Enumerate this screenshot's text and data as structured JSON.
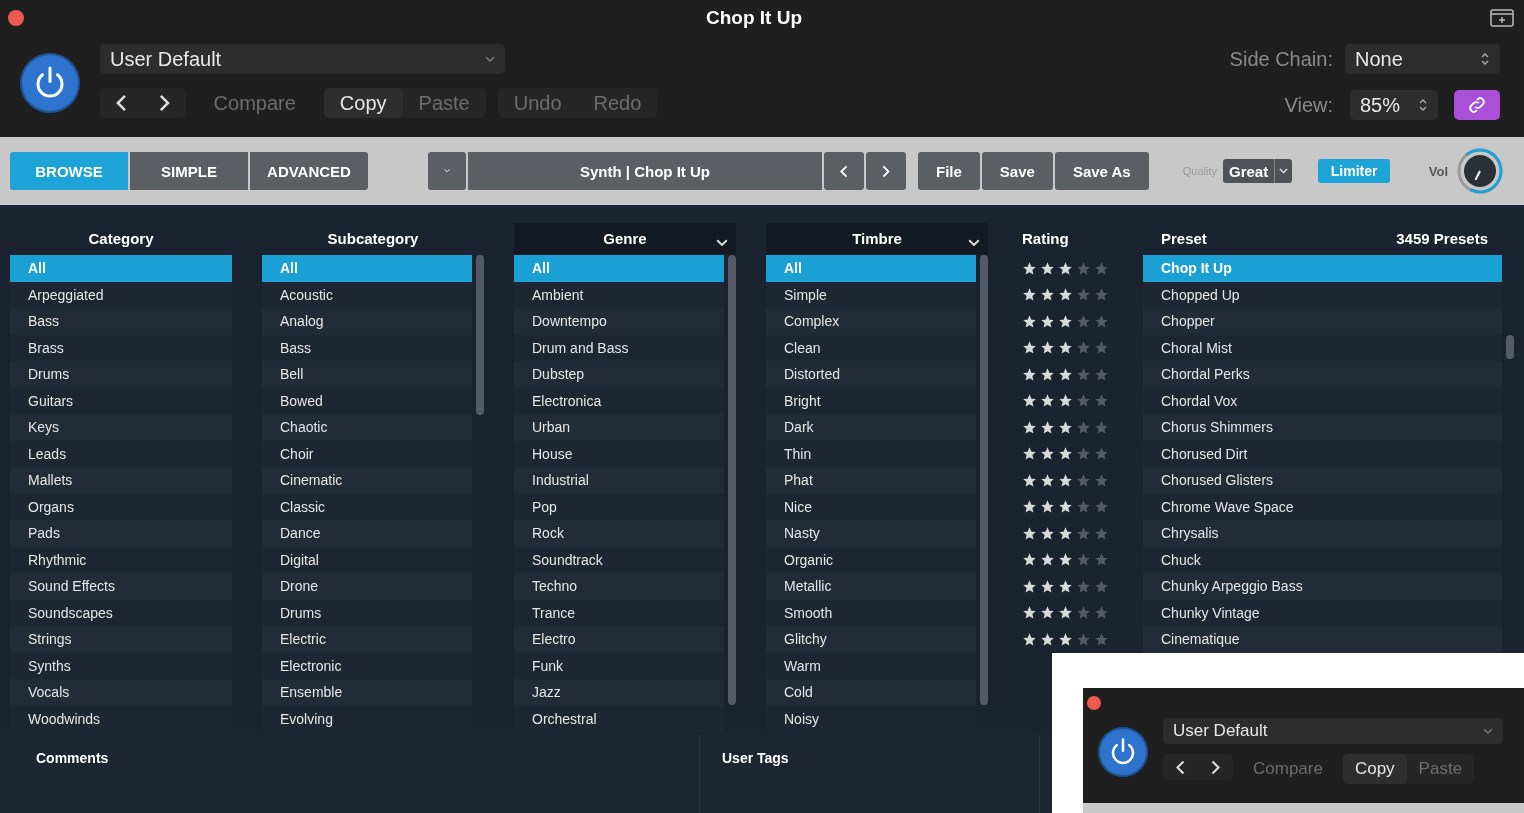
{
  "window": {
    "title": "Chop It Up"
  },
  "header": {
    "preset_menu": "User Default",
    "power_on": true,
    "edit_groups": [
      {
        "buttons": [
          {
            "label": "Compare",
            "disabled": true
          }
        ]
      },
      {
        "buttons": [
          {
            "label": "Copy",
            "disabled": false
          },
          {
            "label": "Paste",
            "disabled": true
          }
        ]
      },
      {
        "buttons": [
          {
            "label": "Undo",
            "disabled": true
          },
          {
            "label": "Redo",
            "disabled": true
          }
        ]
      }
    ],
    "side_chain_label": "Side Chain:",
    "side_chain_value": "None",
    "view_label": "View:",
    "view_value": "85%"
  },
  "toolbar": {
    "tabs": [
      {
        "label": "BROWSE",
        "selected": true
      },
      {
        "label": "SIMPLE",
        "selected": false
      },
      {
        "label": "ADVANCED",
        "selected": false
      }
    ],
    "preset_path": "Synth | Chop It Up",
    "file_buttons": [
      "File",
      "Save",
      "Save As"
    ],
    "quality_label": "Quality",
    "quality_value": "Great",
    "limiter": {
      "label": "Limiter",
      "on": true
    },
    "volume_label": "Vol"
  },
  "filters": [
    {
      "title": "Category",
      "dropdown": false,
      "scrollbar": false,
      "items": [
        {
          "label": "All",
          "selected": true
        },
        {
          "label": "Arpeggiated",
          "selected": false
        },
        {
          "label": "Bass",
          "selected": false
        },
        {
          "label": "Brass",
          "selected": false
        },
        {
          "label": "Drums",
          "selected": false
        },
        {
          "label": "Guitars",
          "selected": false
        },
        {
          "label": "Keys",
          "selected": false
        },
        {
          "label": "Leads",
          "selected": false
        },
        {
          "label": "Mallets",
          "selected": false
        },
        {
          "label": "Organs",
          "selected": false
        },
        {
          "label": "Pads",
          "selected": false
        },
        {
          "label": "Rhythmic",
          "selected": false
        },
        {
          "label": "Sound Effects",
          "selected": false
        },
        {
          "label": "Soundscapes",
          "selected": false
        },
        {
          "label": "Strings",
          "selected": false
        },
        {
          "label": "Synths",
          "selected": false
        },
        {
          "label": "Vocals",
          "selected": false
        },
        {
          "label": "Woodwinds",
          "selected": false
        }
      ]
    },
    {
      "title": "Subcategory",
      "dropdown": false,
      "scrollbar": true,
      "items": [
        {
          "label": "All",
          "selected": true
        },
        {
          "label": "Acoustic",
          "selected": false
        },
        {
          "label": "Analog",
          "selected": false
        },
        {
          "label": "Bass",
          "selected": false
        },
        {
          "label": "Bell",
          "selected": false
        },
        {
          "label": "Bowed",
          "selected": false
        },
        {
          "label": "Chaotic",
          "selected": false
        },
        {
          "label": "Choir",
          "selected": false
        },
        {
          "label": "Cinematic",
          "selected": false
        },
        {
          "label": "Classic",
          "selected": false
        },
        {
          "label": "Dance",
          "selected": false
        },
        {
          "label": "Digital",
          "selected": false
        },
        {
          "label": "Drone",
          "selected": false
        },
        {
          "label": "Drums",
          "selected": false
        },
        {
          "label": "Electric",
          "selected": false
        },
        {
          "label": "Electronic",
          "selected": false
        },
        {
          "label": "Ensemble",
          "selected": false
        },
        {
          "label": "Evolving",
          "selected": false
        }
      ]
    },
    {
      "title": "Genre",
      "dropdown": true,
      "scrollbar": true,
      "items": [
        {
          "label": "All",
          "selected": true
        },
        {
          "label": "Ambient",
          "selected": false
        },
        {
          "label": "Downtempo",
          "selected": false
        },
        {
          "label": "Drum and Bass",
          "selected": false
        },
        {
          "label": "Dubstep",
          "selected": false
        },
        {
          "label": "Electronica",
          "selected": false
        },
        {
          "label": "Urban",
          "selected": false
        },
        {
          "label": "House",
          "selected": false
        },
        {
          "label": "Industrial",
          "selected": false
        },
        {
          "label": "Pop",
          "selected": false
        },
        {
          "label": "Rock",
          "selected": false
        },
        {
          "label": "Soundtrack",
          "selected": false
        },
        {
          "label": "Techno",
          "selected": false
        },
        {
          "label": "Trance",
          "selected": false
        },
        {
          "label": "Electro",
          "selected": false
        },
        {
          "label": "Funk",
          "selected": false
        },
        {
          "label": "Jazz",
          "selected": false
        },
        {
          "label": "Orchestral",
          "selected": false
        }
      ]
    },
    {
      "title": "Timbre",
      "dropdown": true,
      "scrollbar": true,
      "items": [
        {
          "label": "All",
          "selected": true
        },
        {
          "label": "Simple",
          "selected": false
        },
        {
          "label": "Complex",
          "selected": false
        },
        {
          "label": "Clean",
          "selected": false
        },
        {
          "label": "Distorted",
          "selected": false
        },
        {
          "label": "Bright",
          "selected": false
        },
        {
          "label": "Dark",
          "selected": false
        },
        {
          "label": "Thin",
          "selected": false
        },
        {
          "label": "Phat",
          "selected": false
        },
        {
          "label": "Nice",
          "selected": false
        },
        {
          "label": "Nasty",
          "selected": false
        },
        {
          "label": "Organic",
          "selected": false
        },
        {
          "label": "Metallic",
          "selected": false
        },
        {
          "label": "Smooth",
          "selected": false
        },
        {
          "label": "Glitchy",
          "selected": false
        },
        {
          "label": "Warm",
          "selected": false
        },
        {
          "label": "Cold",
          "selected": false
        },
        {
          "label": "Noisy",
          "selected": false
        }
      ]
    }
  ],
  "presets": {
    "rating_header": "Rating",
    "preset_header": "Preset",
    "count": "3459 Presets",
    "rows": [
      {
        "name": "Chop It Up",
        "stars": 3,
        "selected": true
      },
      {
        "name": "Chopped Up",
        "stars": 3,
        "selected": false
      },
      {
        "name": "Chopper",
        "stars": 3,
        "selected": false
      },
      {
        "name": "Choral Mist",
        "stars": 3,
        "selected": false
      },
      {
        "name": "Chordal Perks",
        "stars": 3,
        "selected": false
      },
      {
        "name": "Chordal Vox",
        "stars": 3,
        "selected": false
      },
      {
        "name": "Chorus Shimmers",
        "stars": 3,
        "selected": false
      },
      {
        "name": "Chorused Dirt",
        "stars": 3,
        "selected": false
      },
      {
        "name": "Chorused Glisters",
        "stars": 3,
        "selected": false
      },
      {
        "name": "Chrome Wave Space",
        "stars": 3,
        "selected": false
      },
      {
        "name": "Chrysalis",
        "stars": 3,
        "selected": false
      },
      {
        "name": "Chuck",
        "stars": 3,
        "selected": false
      },
      {
        "name": "Chunky Arpeggio Bass",
        "stars": 3,
        "selected": false
      },
      {
        "name": "Chunky Vintage",
        "stars": 3,
        "selected": false
      },
      {
        "name": "Cinematique",
        "stars": 3,
        "selected": false
      }
    ]
  },
  "comments_label": "Comments",
  "user_tags_label": "User Tags",
  "inset": {
    "preset_menu": "User Default",
    "power_on": true,
    "edit_groups": [
      {
        "buttons": [
          {
            "label": "Compare",
            "disabled": true
          }
        ]
      },
      {
        "buttons": [
          {
            "label": "Copy",
            "disabled": false
          },
          {
            "label": "Paste",
            "disabled": true
          }
        ]
      }
    ]
  }
}
